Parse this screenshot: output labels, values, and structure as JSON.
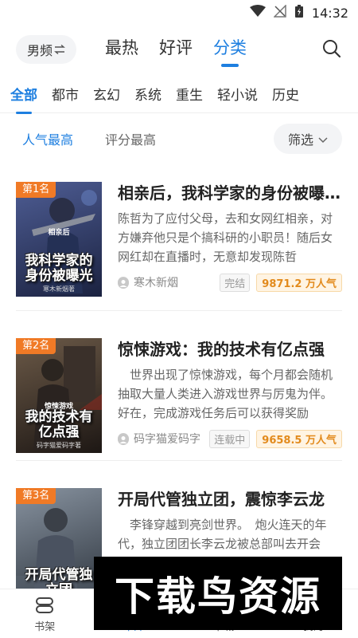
{
  "status_bar": {
    "time": "14:32"
  },
  "header": {
    "gender_label": "男频",
    "tabs": [
      "最热",
      "好评",
      "分类"
    ],
    "active_tab": 2
  },
  "categories": [
    "全部",
    "都市",
    "玄幻",
    "系统",
    "重生",
    "轻小说",
    "历史"
  ],
  "sort": {
    "options": [
      "人气最高",
      "评分最高"
    ],
    "filter_label": "筛选"
  },
  "books": [
    {
      "rank": "第1名",
      "cover_title": "我科学家的身份被曝光",
      "cover_top": "相亲后",
      "cover_author": "寒木新烟著",
      "title": "相亲后，我科学家的身份被曝光了",
      "desc": "陈哲为了应付父母，去和女网红相亲，对方嫌弃他只是个搞科研的小职员！随后女网红却在直播时，无意却发现陈哲",
      "author": "寒木新烟",
      "status": "完结",
      "popularity": "9871.2 万人气",
      "cover_colors": [
        "#3a4a7a",
        "#1b2240"
      ]
    },
    {
      "rank": "第2名",
      "cover_title": "我的技术有亿点强",
      "cover_top": "惊悚游戏",
      "cover_author": "码字猫爱码字著",
      "title": "惊悚游戏：我的技术有亿点强",
      "desc": "　世界出现了惊悚游戏，每个月都会随机抽取大量人类进入游戏世界与厉鬼为伴。　好在，完成游戏任务后可以获得奖励",
      "author": "码字猫爱码字",
      "status": "连载中",
      "popularity": "9658.5 万人气",
      "cover_colors": [
        "#5a4a3a",
        "#1d1714"
      ]
    },
    {
      "rank": "第3名",
      "cover_title": "开局代管独立团",
      "cover_top": "",
      "cover_author": "",
      "title": "开局代管独立团，震惊李云龙",
      "desc": "　李锋穿越到亮剑世界。　炮火连天的年代，独立团团长李云龙被总部叫去开会",
      "author": "",
      "status": "",
      "popularity": "",
      "cover_colors": [
        "#6f7a86",
        "#2c333c"
      ]
    }
  ],
  "bottom_nav": [
    "书架",
    "书库",
    "书城",
    "我的"
  ],
  "watermark": "下载鸟资源",
  "colors": {
    "accent": "#1e7fe0",
    "rank_badge": "#f07a26",
    "popularity": "#e28a1c"
  }
}
